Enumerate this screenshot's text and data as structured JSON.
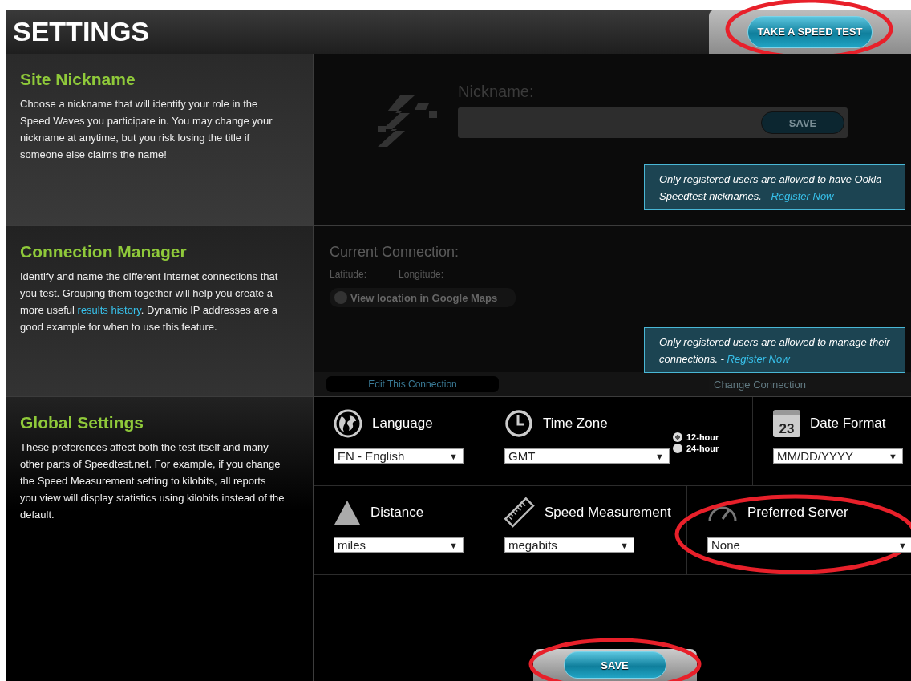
{
  "header": {
    "title": "SETTINGS",
    "speed_test_button": {
      "label": "TAKE A SPEED TEST",
      "highlighted": true
    }
  },
  "nickname": {
    "title": "Site Nickname",
    "description": "Choose a nickname that will identify your role in the Speed Waves you participate in. You may change your nickname at anytime, but you risk losing the title if someone else claims the name!",
    "field_label": "Nickname:",
    "save_label": "SAVE",
    "notice": {
      "text": "Only registered users are allowed to have Ookla Speedtest nicknames. - ",
      "link": "Register Now"
    }
  },
  "connection": {
    "title": "Connection Manager",
    "description_before": "Identify and name the different Internet connections that you test. Grouping them together will help you create a more useful ",
    "description_link": "results history",
    "description_after": ". Dynamic IP addresses are a good example for when to use this feature.",
    "current_label": "Current Connection:",
    "latitude_label": "Latitude:",
    "longitude_label": "Longitude:",
    "maps_button": "View location in Google Maps",
    "edit_button": "Edit This Connection",
    "change_select": "Change Connection",
    "notice": {
      "text": "Only registered users are allowed to manage their connections. - ",
      "link": "Register Now"
    }
  },
  "global": {
    "title": "Global Settings",
    "description": "These preferences affect both the test itself and many other parts of Speedtest.net. For example, if you change the Speed Measurement setting to kilobits, all reports you view will display statistics using kilobits instead of the default.",
    "rows": [
      [
        {
          "kind": "language",
          "label": "Language",
          "value": "EN - English",
          "arrow": "▼",
          "highlighted": false
        },
        {
          "kind": "timezone",
          "label": "Time Zone",
          "value": "GMT",
          "arrow": "▼",
          "highlighted": false,
          "options": [
            {
              "label": "12-hour",
              "selected": true
            },
            {
              "label": "24-hour",
              "selected": false
            }
          ]
        },
        {
          "kind": "date",
          "label": "Date Format",
          "value": "MM/DD/YYYY",
          "arrow": "▼",
          "highlighted": false,
          "icon_text": "23"
        }
      ],
      [
        {
          "kind": "distance",
          "label": "Distance",
          "value": "miles",
          "arrow": "▼",
          "highlighted": false
        },
        {
          "kind": "speed",
          "label": "Speed Measurement",
          "value": "megabits",
          "arrow": "▼",
          "highlighted": false
        },
        {
          "kind": "server",
          "label": "Preferred Server",
          "value": "None",
          "arrow": "▼",
          "highlighted": true
        }
      ]
    ]
  },
  "save_button": {
    "label": "SAVE",
    "highlighted": true
  }
}
